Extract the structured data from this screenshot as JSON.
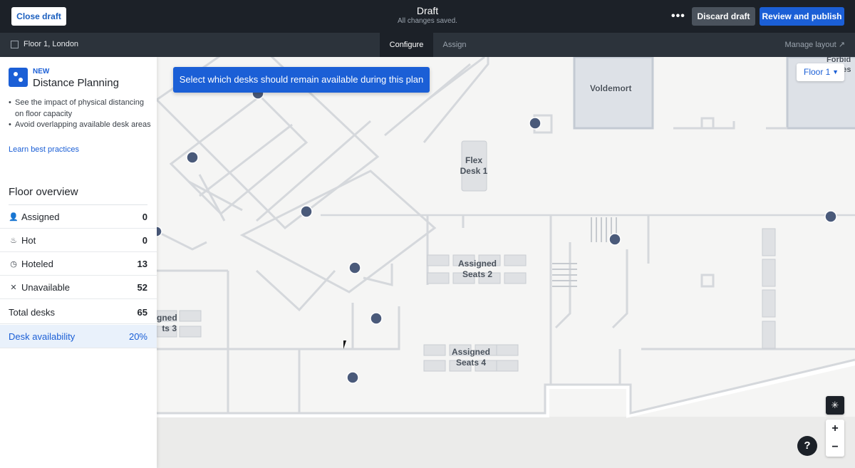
{
  "topbar": {
    "close_label": "Close draft",
    "title": "Draft",
    "subtitle": "All changes saved.",
    "more_label": "•••",
    "discard_label": "Discard draft",
    "publish_label": "Review and publish"
  },
  "subbar": {
    "location": "Floor 1, London",
    "tabs": [
      {
        "label": "Configure",
        "active": true
      },
      {
        "label": "Assign",
        "active": false
      }
    ],
    "manage_label": "Manage layout"
  },
  "promo": {
    "tag": "NEW",
    "title": "Distance Planning",
    "bullets": [
      "See the impact of physical distancing on floor capacity",
      "Avoid overlapping available desk areas"
    ],
    "link": "Learn best practices"
  },
  "overview": {
    "title": "Floor overview",
    "rows": [
      {
        "label": "Assigned",
        "value": "0",
        "icon": "user-plus-icon"
      },
      {
        "label": "Hot",
        "value": "0",
        "icon": "flame-icon"
      },
      {
        "label": "Hoteled",
        "value": "13",
        "icon": "clock-icon"
      },
      {
        "label": "Unavailable",
        "value": "52",
        "icon": "x-icon"
      }
    ],
    "total_label": "Total desks",
    "total_value": "65",
    "availability_label": "Desk availability",
    "availability_value": "20%"
  },
  "map": {
    "tooltip": "Select which desks should remain available during this plan",
    "floor_selector": "Floor 1",
    "labels": {
      "flex1_a": "Flex",
      "flex1_b": "Desk 1",
      "seats2_a": "Assigned",
      "seats2_b": "Seats 2",
      "seats3_a": "gned",
      "seats3_b": "ts 3",
      "seats4_a": "Assigned",
      "seats4_b": "Seats 4",
      "room_voldemort": "Voldemort",
      "room_forbidden_a": "Forbid",
      "room_forbidden_b": "res"
    },
    "zoom_in": "+",
    "zoom_out": "−",
    "help": "?"
  },
  "colors": {
    "topbar_bg": "#1c2128",
    "accent": "#1b5fd6",
    "map_bg": "#f5f5f4"
  }
}
